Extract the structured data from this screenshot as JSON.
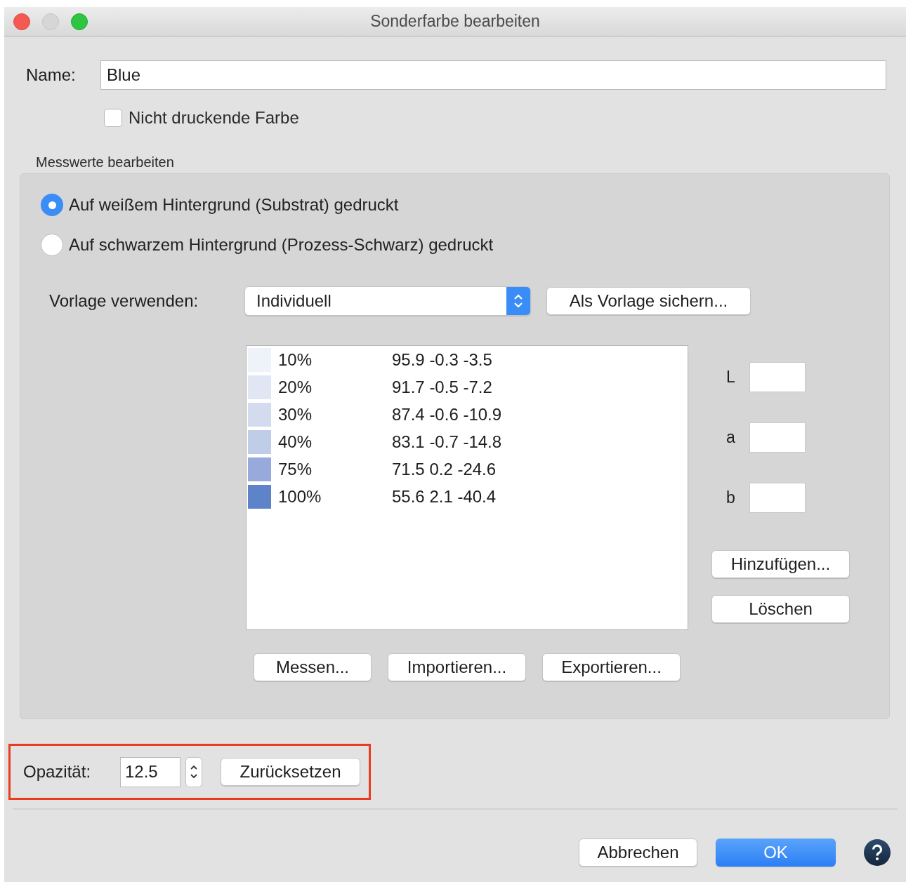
{
  "window": {
    "title": "Sonderfarbe bearbeiten"
  },
  "name_field": {
    "label": "Name:",
    "value": "Blue"
  },
  "non_printing": {
    "label": "Nicht druckende Farbe",
    "checked": false
  },
  "group": {
    "title": "Messwerte bearbeiten",
    "background_options": [
      {
        "label": "Auf weißem Hintergrund (Substrat) gedruckt",
        "selected": true
      },
      {
        "label": "Auf schwarzem Hintergrund (Prozess-Schwarz) gedruckt",
        "selected": false
      }
    ],
    "template": {
      "label": "Vorlage verwenden:",
      "value": "Individuell",
      "save_button": "Als Vorlage sichern..."
    },
    "measurements": [
      {
        "tint": "10%",
        "lab": "95.9 -0.3 -3.5",
        "color": "#eef2f9"
      },
      {
        "tint": "20%",
        "lab": "91.7 -0.5 -7.2",
        "color": "#e0e6f4"
      },
      {
        "tint": "30%",
        "lab": "87.4 -0.6 -10.9",
        "color": "#d2dcee"
      },
      {
        "tint": "40%",
        "lab": "83.1 -0.7 -14.8",
        "color": "#c0cde8"
      },
      {
        "tint": "75%",
        "lab": "71.5 0.2 -24.6",
        "color": "#98aadb"
      },
      {
        "tint": "100%",
        "lab": "55.6 2.1 -40.4",
        "color": "#5f83c9"
      }
    ],
    "lab_fields": [
      {
        "label": "L"
      },
      {
        "label": "a"
      },
      {
        "label": "b"
      }
    ],
    "side_buttons": [
      "Hinzufügen...",
      "Löschen"
    ],
    "list_buttons": [
      "Messen...",
      "Importieren...",
      "Exportieren..."
    ]
  },
  "opacity": {
    "label": "Opazität:",
    "value": "12.5",
    "reset_button": "Zurücksetzen",
    "highlighted": true
  },
  "buttons": [
    {
      "label": "Abbrechen",
      "default": false
    },
    {
      "label": "OK",
      "default": true
    }
  ]
}
